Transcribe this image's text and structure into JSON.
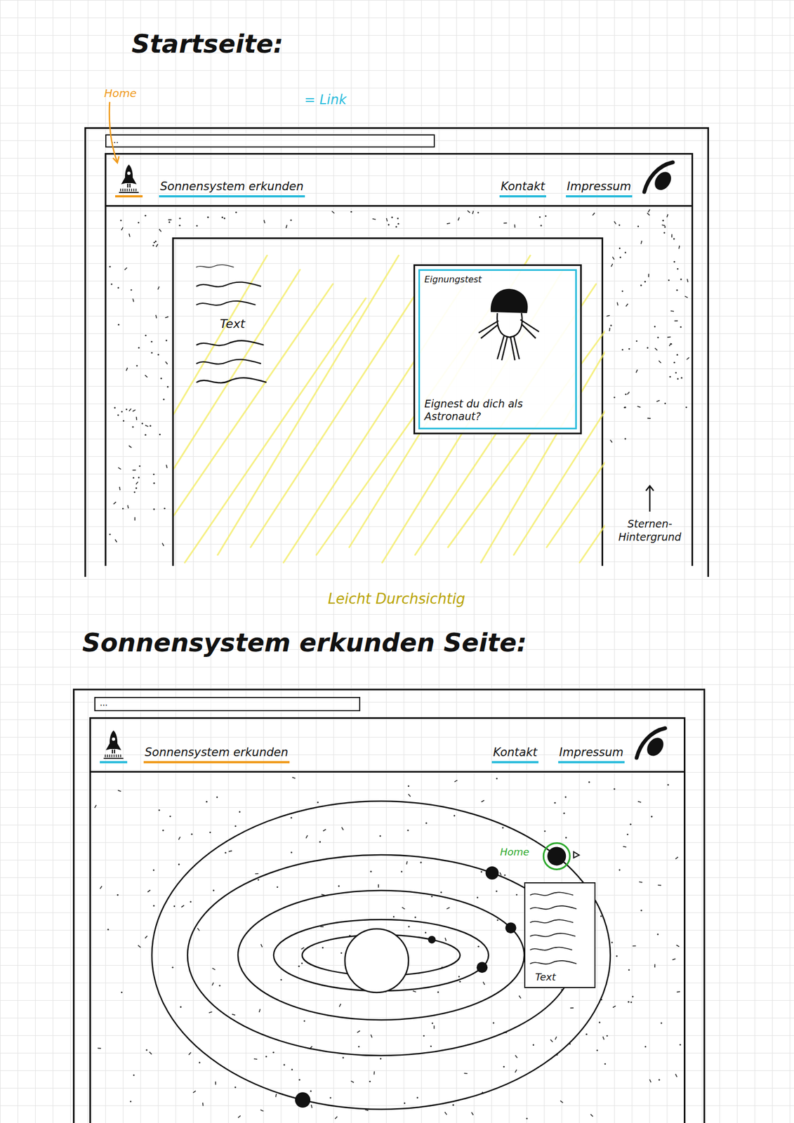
{
  "legend": [
    {
      "label": "Home",
      "color": "#f09a1a"
    },
    {
      "label": "= Link",
      "color": "#2bbcdc"
    }
  ],
  "startseite": {
    "heading": "Startseite:",
    "address": "...",
    "nav": {
      "home": {
        "selected": true
      },
      "links": [
        {
          "label": "Sonnensystem erkunden",
          "selected": false
        }
      ],
      "side_links": [
        {
          "label": "Kontakt",
          "selected": false
        },
        {
          "label": "Impressum",
          "selected": false
        }
      ]
    },
    "content": {
      "text_label": "Text",
      "card": {
        "title": "Eignungstest",
        "caption": "Eignest du dich als Astronaut?"
      }
    },
    "background_note": "Sternen-Hintergrund",
    "overlay_note": "Leicht Durchsichtig"
  },
  "sonnensystem": {
    "heading": "Sonnensystem erkunden Seite:",
    "address": "...",
    "nav": {
      "home": {
        "selected": false
      },
      "links": [
        {
          "label": "Sonnensystem erkunden",
          "selected": true
        }
      ],
      "side_links": [
        {
          "label": "Kontakt",
          "selected": false
        },
        {
          "label": "Impressum",
          "selected": false
        }
      ]
    },
    "marker": {
      "label": "Home",
      "color": "#2aa82a"
    },
    "info_box": {
      "text_label": "Text"
    },
    "planets": [
      {
        "selected": false
      },
      {
        "selected": false
      },
      {
        "selected": false
      },
      {
        "selected": false
      },
      {
        "selected": true
      },
      {
        "selected": false
      }
    ]
  }
}
